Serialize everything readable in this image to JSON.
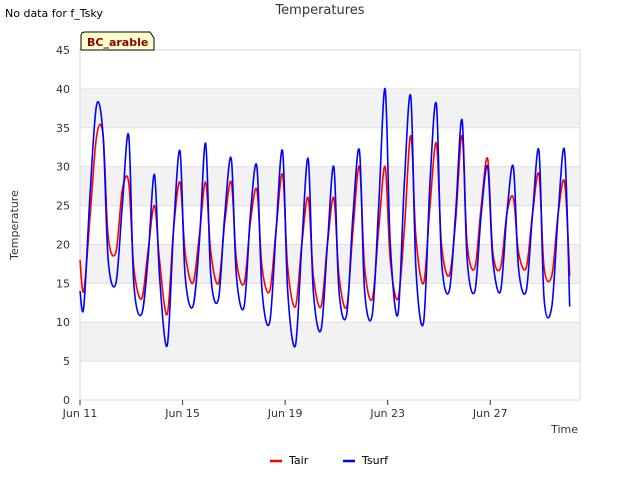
{
  "notice": "No data for f_Tsky",
  "chart_data": {
    "type": "line",
    "title": "Temperatures",
    "xlabel": "Time",
    "ylabel": "Temperature",
    "ylim": [
      0,
      45
    ],
    "yticks": [
      0,
      5,
      10,
      15,
      20,
      25,
      30,
      35,
      40,
      45
    ],
    "xlim": [
      0,
      19.5
    ],
    "xticks": [
      {
        "label": "Jun 11",
        "day": 0
      },
      {
        "label": "Jun 15",
        "day": 4
      },
      {
        "label": "Jun 19",
        "day": 8
      },
      {
        "label": "Jun 23",
        "day": 12
      },
      {
        "label": "Jun 27",
        "day": 16
      }
    ],
    "grid": true,
    "banding": true,
    "legend_position": "bottom-center",
    "site_badge": "BC_arable",
    "series": [
      {
        "name": "Tair",
        "color": "#ff0000",
        "x": [
          0.0,
          0.15,
          0.4,
          0.65,
          0.9,
          1.1,
          1.4,
          1.65,
          1.9,
          2.1,
          2.4,
          2.65,
          2.9,
          3.1,
          3.4,
          3.65,
          3.9,
          4.1,
          4.4,
          4.65,
          4.9,
          5.1,
          5.4,
          5.65,
          5.9,
          6.1,
          6.4,
          6.65,
          6.9,
          7.1,
          7.4,
          7.65,
          7.9,
          8.1,
          8.4,
          8.65,
          8.9,
          9.1,
          9.4,
          9.65,
          9.9,
          10.1,
          10.4,
          10.65,
          10.9,
          11.1,
          11.4,
          11.65,
          11.9,
          12.1,
          12.4,
          12.65,
          12.9,
          13.1,
          13.4,
          13.65,
          13.9,
          14.1,
          14.4,
          14.65,
          14.9,
          15.1,
          15.4,
          15.65,
          15.9,
          16.1,
          16.4,
          16.65,
          16.9,
          17.1,
          17.4,
          17.65,
          17.9,
          18.1,
          18.4,
          18.65,
          18.9,
          19.1
        ],
        "y": [
          18,
          14,
          24,
          34,
          34,
          21,
          19,
          27,
          28,
          17,
          13,
          19,
          25,
          18,
          11,
          22,
          28,
          19,
          15,
          21,
          28,
          19,
          15,
          23,
          28,
          18,
          15,
          23,
          27,
          17,
          14,
          22,
          29,
          17,
          12,
          20,
          26,
          16,
          12,
          20,
          26,
          16,
          12,
          22,
          30,
          17,
          13,
          22,
          30,
          18,
          13,
          22,
          34,
          21,
          15,
          25,
          33,
          20,
          16,
          23,
          34,
          20,
          17,
          25,
          31,
          19,
          17,
          24,
          26,
          19,
          17,
          24,
          29,
          17,
          16,
          24,
          28,
          16
        ]
      },
      {
        "name": "Tsurf",
        "color": "#0000ff",
        "x": [
          0.0,
          0.15,
          0.4,
          0.65,
          0.9,
          1.1,
          1.4,
          1.65,
          1.9,
          2.1,
          2.4,
          2.65,
          2.9,
          3.1,
          3.4,
          3.65,
          3.9,
          4.1,
          4.4,
          4.65,
          4.9,
          5.1,
          5.4,
          5.65,
          5.9,
          6.1,
          6.4,
          6.65,
          6.9,
          7.1,
          7.4,
          7.65,
          7.9,
          8.1,
          8.4,
          8.65,
          8.9,
          9.1,
          9.4,
          9.65,
          9.9,
          10.1,
          10.4,
          10.65,
          10.9,
          11.1,
          11.4,
          11.65,
          11.9,
          12.1,
          12.4,
          12.65,
          12.9,
          13.1,
          13.4,
          13.65,
          13.9,
          14.1,
          14.4,
          14.65,
          14.9,
          15.1,
          15.4,
          15.65,
          15.9,
          16.1,
          16.4,
          16.65,
          16.9,
          17.1,
          17.4,
          17.65,
          17.9,
          18.1,
          18.4,
          18.65,
          18.9,
          19.1
        ],
        "y": [
          14,
          12,
          27,
          38,
          34,
          18,
          15,
          25,
          34,
          15,
          11,
          18,
          29,
          16,
          7,
          22,
          32,
          16,
          12,
          20,
          33,
          16,
          13,
          24,
          31,
          16,
          12,
          24,
          30,
          14,
          10,
          22,
          32,
          14,
          7,
          20,
          31,
          14,
          9,
          20,
          30,
          14,
          11,
          24,
          32,
          14,
          11,
          25,
          40,
          20,
          11,
          28,
          39,
          17,
          10,
          28,
          38,
          18,
          14,
          24,
          36,
          18,
          14,
          24,
          30,
          18,
          14,
          24,
          30,
          17,
          14,
          24,
          32,
          13,
          12,
          24,
          32,
          12
        ]
      }
    ]
  }
}
